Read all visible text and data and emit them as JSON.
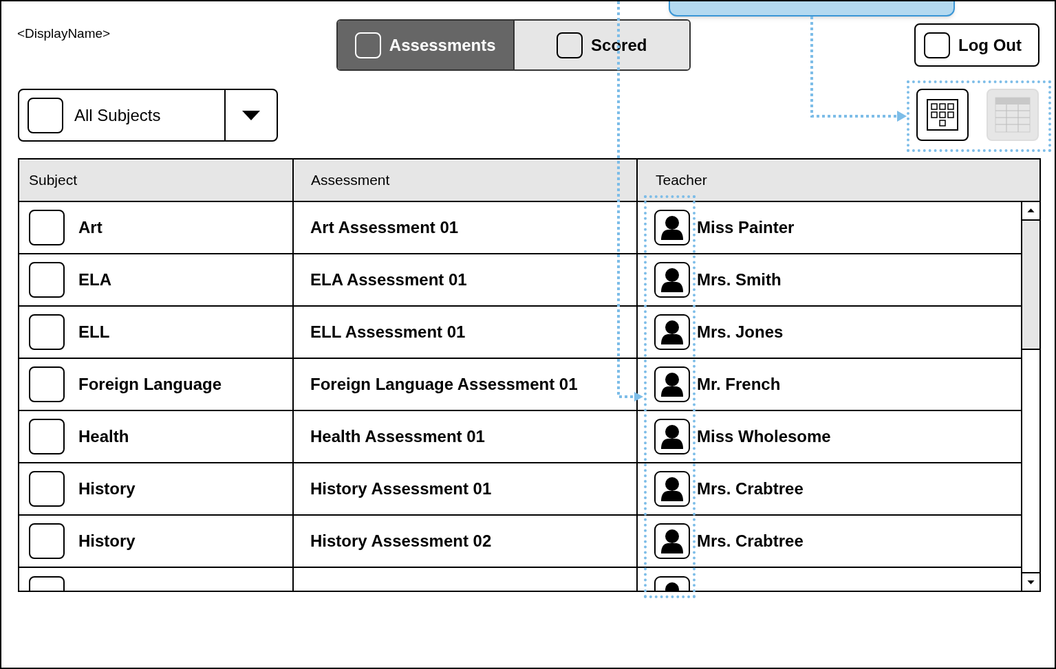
{
  "display_name": "<DisplayName>",
  "tabs": [
    {
      "label": "Assessments",
      "selected": true
    },
    {
      "label": "Scored",
      "selected": false
    }
  ],
  "log_out": "Log Out",
  "filter": {
    "value": "All Subjects"
  },
  "view_toggles": [
    {
      "kind": "grid",
      "selected": true
    },
    {
      "kind": "table",
      "selected": false
    }
  ],
  "table": {
    "columns": [
      "Subject",
      "Assessment",
      "Teacher"
    ],
    "rows": [
      {
        "subject": "Art",
        "assessment": "Art Assessment 01",
        "teacher": "Miss Painter"
      },
      {
        "subject": "ELA",
        "assessment": "ELA Assessment 01",
        "teacher": "Mrs. Smith"
      },
      {
        "subject": "ELL",
        "assessment": "ELL Assessment 01",
        "teacher": "Mrs. Jones"
      },
      {
        "subject": "Foreign Language",
        "assessment": "Foreign Language Assessment 01",
        "teacher": "Mr. French"
      },
      {
        "subject": "Health",
        "assessment": "Health Assessment 01",
        "teacher": "Miss Wholesome"
      },
      {
        "subject": "History",
        "assessment": "History Assessment 01",
        "teacher": "Mrs. Crabtree"
      },
      {
        "subject": "History",
        "assessment": "History Assessment 02",
        "teacher": "Mrs. Crabtree"
      }
    ],
    "cut_off_row": true
  }
}
